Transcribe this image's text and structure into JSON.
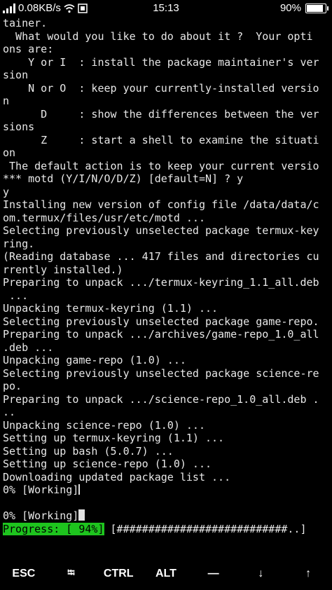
{
  "status_bar": {
    "network_speed": "0.08KB/s",
    "time": "15:13",
    "battery_percent": "90%",
    "battery_level": 0.9
  },
  "terminal": {
    "lines": [
      "tainer.",
      "  What would you like to do about it ?  Your opti",
      "ons are:",
      "    Y or I  : install the package maintainer's ver",
      "sion",
      "    N or O  : keep your currently-installed versio",
      "n",
      "      D     : show the differences between the ver",
      "sions",
      "      Z     : start a shell to examine the situati",
      "on",
      " The default action is to keep your current versio",
      "*** motd (Y/I/N/O/D/Z) [default=N] ? y",
      "y",
      "Installing new version of config file /data/data/c",
      "om.termux/files/usr/etc/motd ...",
      "Selecting previously unselected package termux-key",
      "ring.",
      "(Reading database ... 417 files and directories cu",
      "rrently installed.)",
      "Preparing to unpack .../termux-keyring_1.1_all.deb",
      " ...",
      "Unpacking termux-keyring (1.1) ...",
      "Selecting previously unselected package game-repo.",
      "Preparing to unpack .../archives/game-repo_1.0_all",
      ".deb ...",
      "Unpacking game-repo (1.0) ...",
      "Selecting previously unselected package science-re",
      "po.",
      "Preparing to unpack .../science-repo_1.0_all.deb .",
      "..",
      "Unpacking science-repo (1.0) ...",
      "Setting up termux-keyring (1.1) ...",
      "Setting up bash (5.0.7) ...",
      "Setting up science-repo (1.0) ...",
      "Downloading updated package list ..."
    ],
    "working_line_1": "0% [Working]",
    "blank_line": "",
    "working_line_2": "0% [Working]",
    "progress_label": "Progress: [ 94%]",
    "progress_bar": " [###########################..]"
  },
  "extra_keys": {
    "esc": "ESC",
    "tab": "⭾",
    "ctrl": "CTRL",
    "alt": "ALT",
    "dash": "—",
    "down": "↓",
    "up": "↑"
  },
  "colors": {
    "background": "#000000",
    "text": "#e8e8e8",
    "progress_green": "#1ec41e"
  }
}
